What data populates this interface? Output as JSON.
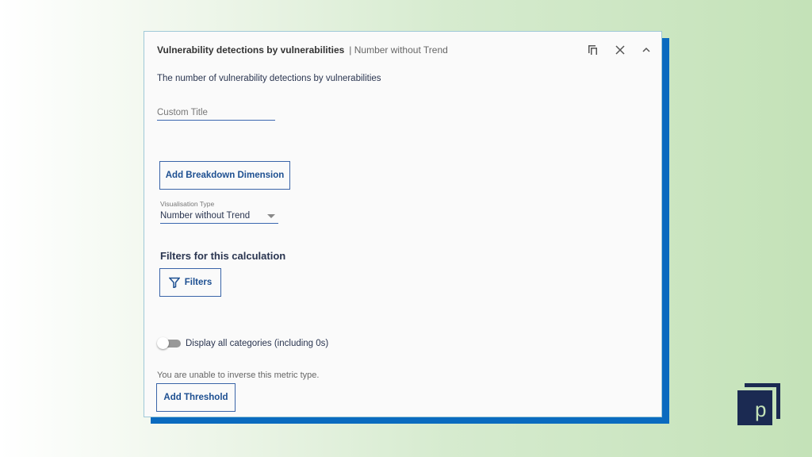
{
  "panel": {
    "title": "Vulnerability detections by vulnerabilities",
    "subtitle": "| Number without Trend",
    "description": "The number of vulnerability detections by vulnerabilities",
    "custom_title_placeholder": "Custom Title",
    "add_breakdown_label": "Add Breakdown Dimension",
    "visualisation_label": "Visualisation Type",
    "visualisation_value": "Number without Trend",
    "filters_heading": "Filters for this calculation",
    "filters_label": "Filters",
    "toggle_label": "Display all categories (including 0s)",
    "toggle_on": false,
    "inverse_note": "You are unable to inverse this metric type.",
    "add_threshold_label": "Add Threshold"
  },
  "logo": {
    "letter": "p"
  },
  "colors": {
    "accent": "#1d4f91",
    "shadow": "#0a6bbf",
    "logo": "#1b2a52"
  }
}
